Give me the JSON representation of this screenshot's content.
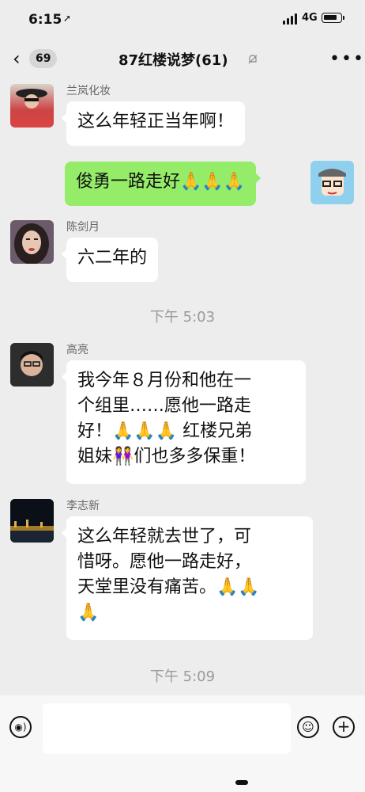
{
  "status_bar": {
    "time": "6:15",
    "location_icon": "location-arrow",
    "network": "4G",
    "battery_level": 0.8
  },
  "header": {
    "back_count": "69",
    "title": "87红楼说梦(61)",
    "mute_icon": "bell-mute",
    "more_icon": "more-dots"
  },
  "messages": [
    {
      "sender": "兰岚化妆",
      "text": "这么年轻正当年啊！"
    },
    {
      "sender": "",
      "text": "俊勇一路走好🙏🙏🙏"
    },
    {
      "sender": "陈剑月",
      "text": "六二年的"
    },
    {
      "time_separator": "下午 5:03"
    },
    {
      "sender": "高亮",
      "lines": [
        "我今年８月份和他在一",
        "个组里……愿他一路走",
        "好！🙏🙏🙏 红楼兄弟",
        "姐妹👭们也多多保重！"
      ]
    },
    {
      "sender": "李志新",
      "lines": [
        "这么年轻就去世了，可",
        "惜呀。愿他一路走好，",
        "天堂里没有痛苦。🙏🙏",
        "🙏"
      ]
    },
    {
      "time_separator": "下午 5:09"
    }
  ],
  "colors": {
    "background": "#ededed",
    "bubble_in": "#ffffff",
    "bubble_out": "#95ec69"
  }
}
